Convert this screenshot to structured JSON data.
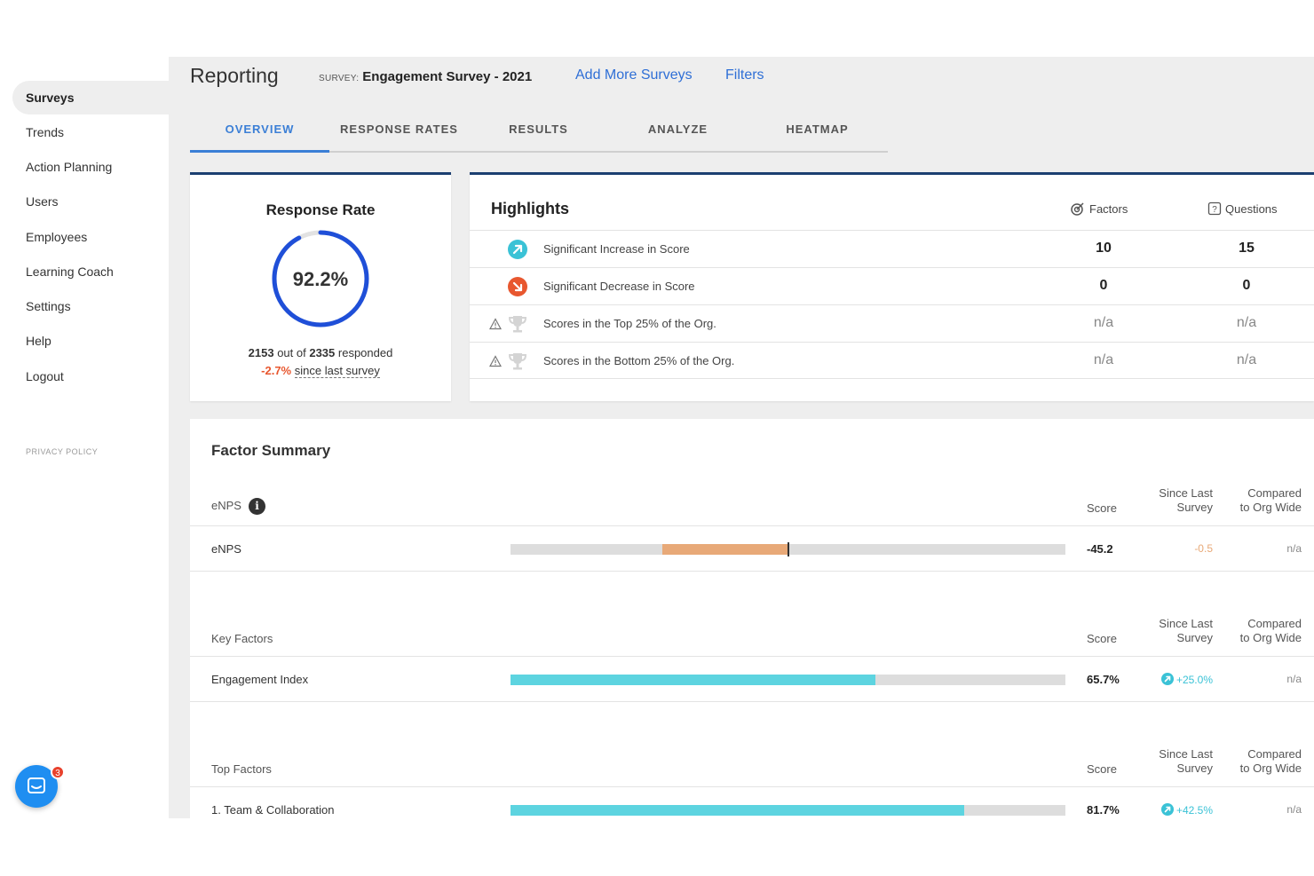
{
  "sidebar": {
    "items": [
      {
        "label": "Surveys",
        "active": true
      },
      {
        "label": "Trends",
        "active": false
      },
      {
        "label": "Action Planning",
        "active": false
      },
      {
        "label": "Users",
        "active": false
      },
      {
        "label": "Employees",
        "active": false
      },
      {
        "label": "Learning Coach",
        "active": false
      },
      {
        "label": "Settings",
        "active": false
      },
      {
        "label": "Help",
        "active": false
      },
      {
        "label": "Logout",
        "active": false
      }
    ],
    "privacy_label": "PRIVACY POLICY",
    "chat_badge": "3"
  },
  "header": {
    "title": "Reporting",
    "survey_prefix": "SURVEY:",
    "survey_name": "Engagement Survey - 2021",
    "add_surveys_link": "Add More Surveys",
    "filters_link": "Filters"
  },
  "tabs": [
    {
      "label": "OVERVIEW",
      "active": true
    },
    {
      "label": "RESPONSE RATES",
      "active": false
    },
    {
      "label": "RESULTS",
      "active": false
    },
    {
      "label": "ANALYZE",
      "active": false
    },
    {
      "label": "HEATMAP",
      "active": false
    }
  ],
  "response_rate": {
    "title": "Response Rate",
    "value_text": "92.2%",
    "value_fraction": 0.922,
    "responded_count": "2153",
    "out_of_text": "out of",
    "total_count": "2335",
    "responded_text": "responded",
    "change": "-2.7%",
    "since_text": "since last survey"
  },
  "highlights": {
    "title": "Highlights",
    "col_factors": "Factors",
    "col_questions": "Questions",
    "rows": [
      {
        "label": "Significant Increase in Score",
        "icon": "increase-arrow-icon",
        "factors": "10",
        "questions": "15",
        "warning": false
      },
      {
        "label": "Significant Decrease in Score",
        "icon": "decrease-arrow-icon",
        "factors": "0",
        "questions": "0",
        "warning": false
      },
      {
        "label": "Scores in the Top 25% of the Org.",
        "icon": "trophy-icon",
        "factors": "n/a",
        "questions": "n/a",
        "warning": true
      },
      {
        "label": "Scores in the Bottom 25% of the Org.",
        "icon": "trophy-icon",
        "factors": "n/a",
        "questions": "n/a",
        "warning": true
      }
    ]
  },
  "factor_summary": {
    "title": "Factor Summary",
    "col_score": "Score",
    "col_since_line1": "Since Last",
    "col_since_line2": "Survey",
    "col_org_line1": "Compared",
    "col_org_line2": "to Org Wide",
    "groups": [
      {
        "name": "eNPS",
        "has_info": true,
        "rows": [
          {
            "name": "eNPS",
            "score": "-45.2",
            "score_value": -45.2,
            "since": "-0.5",
            "since_trend": "down",
            "org": "n/a",
            "bar_color": "#e8a978"
          }
        ]
      },
      {
        "name": "Key Factors",
        "has_info": false,
        "rows": [
          {
            "name": "Engagement Index",
            "score": "65.7%",
            "score_value": 0.657,
            "since": "+25.0%",
            "since_trend": "up",
            "org": "n/a",
            "bar_color": "#5dd4e0"
          }
        ]
      },
      {
        "name": "Top Factors",
        "has_info": false,
        "rows": [
          {
            "name": "1. Team & Collaboration",
            "score": "81.7%",
            "score_value": 0.817,
            "since": "+42.5%",
            "since_trend": "up",
            "org": "n/a",
            "bar_color": "#5dd4e0"
          }
        ]
      }
    ]
  },
  "colors": {
    "accent_blue": "#3b7fd6",
    "link_blue": "#2f6fd6",
    "card_border": "#1c3f71",
    "ring_blue": "#1f4fd8",
    "positive": "#3ac2d6",
    "negative": "#e8572f"
  }
}
